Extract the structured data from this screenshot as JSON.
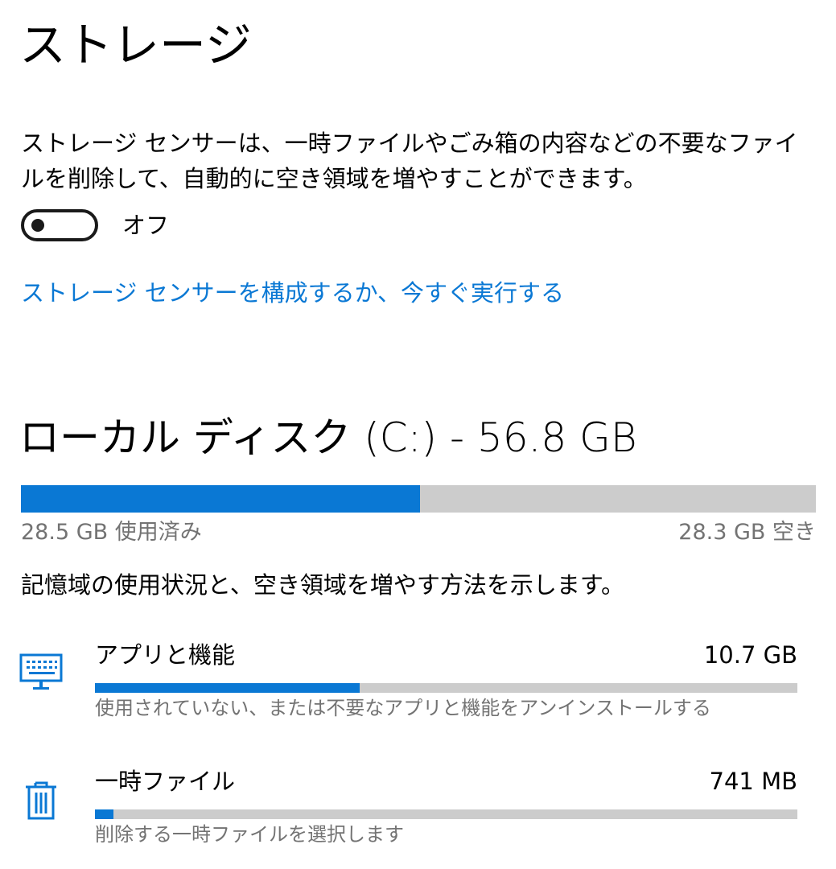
{
  "header": {
    "title": "ストレージ"
  },
  "storage_sense": {
    "description": "ストレージ センサーは、一時ファイルやごみ箱の内容などの不要なファイルを削除して、自動的に空き領域を増やすことができます。",
    "toggle_on": false,
    "toggle_label": "オフ",
    "configure_link": "ストレージ センサーを構成するか、今すぐ実行する"
  },
  "disk": {
    "title": "ローカル ディスク (C:) - 56.8 GB",
    "used_fraction": 0.502,
    "used_label": "28.5 GB 使用済み",
    "free_label": "28.3 GB 空き",
    "caption": "記憶域の使用状況と、空き領域を増やす方法を示します。"
  },
  "categories": [
    {
      "icon": "keyboard-monitor-icon",
      "name": "アプリと機能",
      "size": "10.7 GB",
      "fraction": 0.377,
      "description": "使用されていない、または不要なアプリと機能をアンインストールする"
    },
    {
      "icon": "trash-icon",
      "name": "一時ファイル",
      "size": "741 MB",
      "fraction": 0.026,
      "description": "削除する一時ファイルを選択します"
    }
  ],
  "colors": {
    "accent": "#0a78d4",
    "track": "#cccccc",
    "secondary_text": "#737373"
  }
}
